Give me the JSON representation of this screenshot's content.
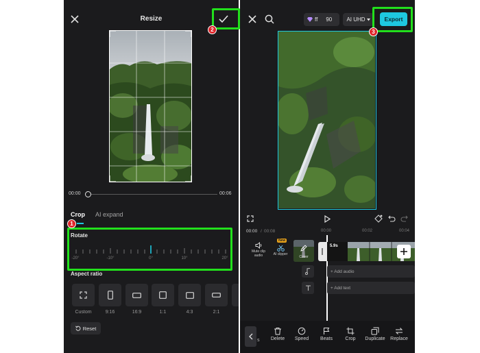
{
  "left_panel": {
    "title": "Resize",
    "time_start": "00:00",
    "time_end": "00:06",
    "tabs": [
      {
        "label": "Crop",
        "active": true
      },
      {
        "label": "AI expand",
        "active": false
      }
    ],
    "rotate_label": "Rotate",
    "rotate_ticks": [
      "-20°",
      "-10°",
      "0°",
      "10°",
      "20°"
    ],
    "aspect_ratio_label": "Aspect ratio",
    "aspect_ratios": [
      "Custom",
      "9:16",
      "16:9",
      "1:1",
      "4:3",
      "2:1"
    ],
    "reset_label": "Reset"
  },
  "right_panel": {
    "pro_badge_text": "ff",
    "pro_badge_number": "90",
    "quality_label": "AI UHD",
    "export_label": "Export",
    "time_current": "00:00",
    "time_total": "00:08",
    "ruler_marks": [
      "00:00",
      "00:02",
      "00:04"
    ],
    "clip_duration": "5.9s",
    "left_tools": [
      {
        "label": "Mute clip audio"
      },
      {
        "label": "AI clipper",
        "badge": "New"
      },
      {
        "label": "Cover"
      }
    ],
    "add_audio_label": "+ Add audio",
    "add_text_label": "+ Add text",
    "bottom_tools": [
      "Delete",
      "Speed",
      "Beats",
      "Crop",
      "Duplicate",
      "Replace"
    ]
  },
  "callouts": [
    "1",
    "2",
    "3"
  ],
  "colors": {
    "panel_bg": "#1b1b1d",
    "highlight": "#22e01c",
    "accent": "#1ec8e0",
    "callout": "#e0252a"
  },
  "icons": [
    "close-icon",
    "check-icon",
    "search-icon",
    "diamond-icon",
    "expand-icon",
    "play-icon",
    "keyframe-icon",
    "undo-icon",
    "redo-icon",
    "speaker-icon",
    "scissors-icon",
    "pencil-icon",
    "music-note-icon",
    "text-icon",
    "plus-icon",
    "chevron-left-icon",
    "reset-icon"
  ]
}
